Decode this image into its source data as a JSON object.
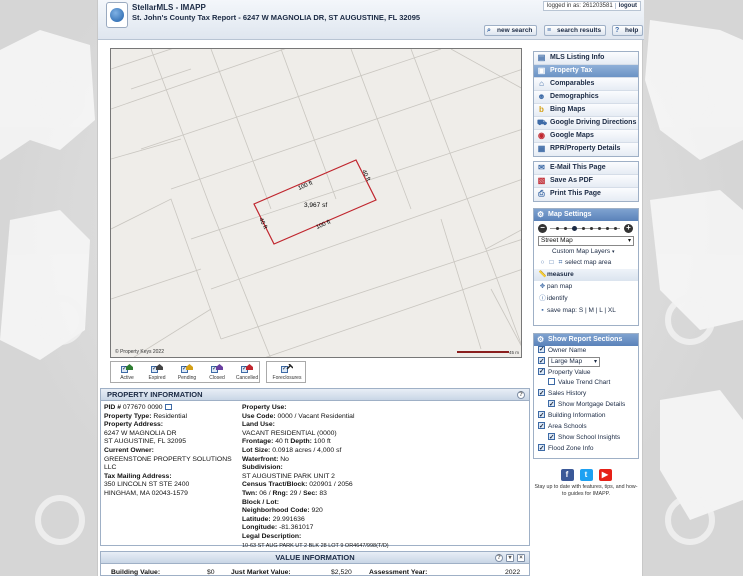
{
  "header": {
    "app_title": "StellarMLS - IMAPP",
    "report_title": "St. John's County Tax Report - 6247 W MAGNOLIA DR, ST AUGUSTINE, FL 32095",
    "login_text": "logged in as: 261203581",
    "logout_label": "logout",
    "buttons": [
      {
        "label": "new search",
        "icon": "search-icon"
      },
      {
        "label": "search results",
        "icon": "list-icon"
      },
      {
        "label": "help",
        "icon": "help-icon"
      }
    ]
  },
  "map": {
    "labels": {
      "top": "100 ft",
      "right": "40 ft",
      "bottom": "100 ft",
      "left": "40 ft",
      "area": "3,967 sf"
    },
    "copyright": "© Property Keys 2022",
    "scale_label": "45 m"
  },
  "legend": {
    "items": [
      "Active",
      "Expired",
      "Pending",
      "Closed",
      "Cancelled"
    ],
    "foreclosures": "Foreclosures"
  },
  "property": {
    "title": "PROPERTY INFORMATION",
    "left": {
      "pid_label": "PID #",
      "pid": "077670 0090",
      "type_label": "Property Type:",
      "type": "Residential",
      "address_label": "Property Address:",
      "address1": "6247 W MAGNOLIA DR",
      "address2": "ST AUGUSTINE, FL 32095",
      "owner_label": "Current Owner:",
      "owner": "GREENSTONE PROPERTY SOLUTIONS LLC",
      "mailing_label": "Tax Mailing Address:",
      "mailing1": "350 LINCOLN ST STE 2400",
      "mailing2": "HINGHAM, MA 02043-1579"
    },
    "right": {
      "use_label": "Property Use:",
      "use_code_label": "Use Code:",
      "use_code": "0000 / Vacant Residential",
      "land_use_label": "Land Use:",
      "land_use": "VACANT RESIDENTIAL (0000)",
      "frontage_label": "Frontage:",
      "frontage": "40 ft",
      "depth_label": "Depth:",
      "depth": "100 ft",
      "lot_label": "Lot Size:",
      "lot": "0.0918 acres / 4,000 sf",
      "waterfront_label": "Waterfront:",
      "waterfront": "No",
      "subdivision_label": "Subdivision:",
      "subdivision": "ST AUGUSTINE PARK UNIT 2",
      "census_label": "Census Tract/Block:",
      "census": "020901 / 2056",
      "twn_label": "Twn:",
      "twn": "06",
      "rng_label": "Rng:",
      "rng": "29",
      "sec_label": "Sec:",
      "sec": "83",
      "block_label": "Block / Lot:",
      "neighborhood_label": "Neighborhood Code:",
      "neighborhood": "920",
      "lat_label": "Latitude:",
      "lat": "29.991636",
      "lon_label": "Longitude:",
      "lon": "-81.361017",
      "legal_label": "Legal Description:",
      "legal": "10-63 ST AUG PARK UT 2 BLK 28 LOT 9 OR4647/998(T/D)"
    }
  },
  "value": {
    "title": "VALUE INFORMATION",
    "building_label": "Building Value:",
    "building": "$0",
    "market_label": "Just Market Value:",
    "market": "$2,520",
    "year_label": "Assessment Year:",
    "year": "2022"
  },
  "sidebar": {
    "links": [
      {
        "label": "MLS Listing Info",
        "icon": "listing-icon",
        "active": false
      },
      {
        "label": "Property Tax",
        "icon": "tax-icon",
        "active": true
      },
      {
        "label": "Comparables",
        "icon": "comparables-icon",
        "active": false
      },
      {
        "label": "Demographics",
        "icon": "demographics-icon",
        "active": false
      },
      {
        "label": "Bing Maps",
        "icon": "bing-icon",
        "active": false
      },
      {
        "label": "Google Driving Directions",
        "icon": "directions-icon",
        "active": false
      },
      {
        "label": "Google Maps",
        "icon": "google-maps-icon",
        "active": false
      },
      {
        "label": "RPR/Property Details",
        "icon": "rpr-icon",
        "active": false
      }
    ],
    "actions": [
      {
        "label": "E-Mail This Page",
        "icon": "email-icon"
      },
      {
        "label": "Save As PDF",
        "icon": "pdf-icon"
      },
      {
        "label": "Print This Page",
        "icon": "print-icon"
      }
    ],
    "map_settings": {
      "title": "Map Settings",
      "map_type": "Street Map",
      "custom_layers": "Custom Map Layers",
      "select_area": "select map area",
      "measure": "measure",
      "pan": "pan map",
      "identify": "identify",
      "save_map": "save map:",
      "save_opts": [
        "S",
        "M",
        "L",
        "XL"
      ]
    },
    "report_sections": {
      "title": "Show Report Sections",
      "owner_name": "Owner Name",
      "map_size": "Large Map",
      "property_value": "Property Value",
      "value_trend": "Value Trend Chart",
      "sales_history": "Sales History",
      "mortgage": "Show Mortgage Details",
      "building": "Building Information",
      "area_schools": "Area Schools",
      "school_insights": "Show School Insights",
      "flood_zone": "Flood Zone Info"
    },
    "social_text": "Stay up to date with features, tips, and how-to guides for IMAPP."
  }
}
